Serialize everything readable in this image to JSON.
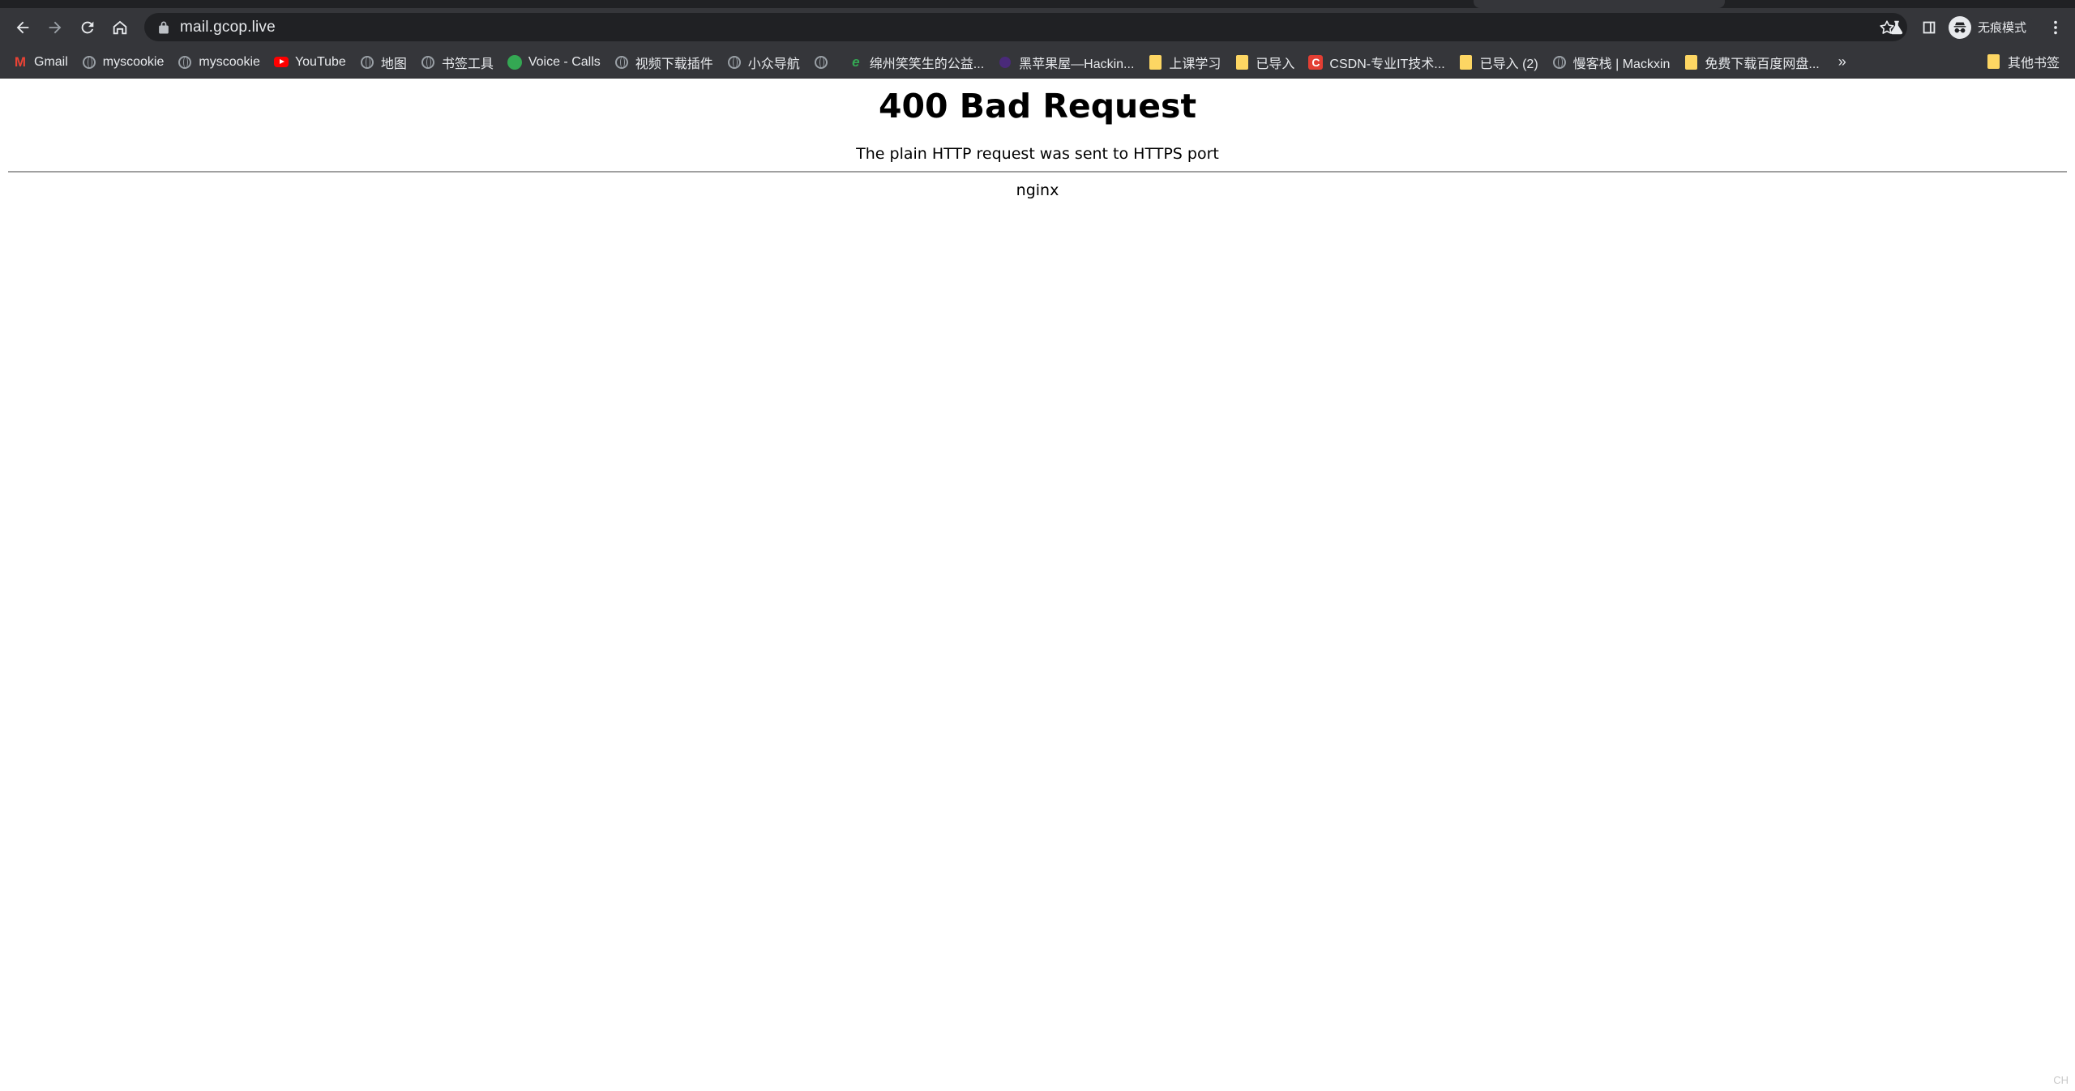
{
  "browser": {
    "url": "mail.gcop.live",
    "profile_label": "无痕模式"
  },
  "bookmarks": [
    {
      "label": "Gmail",
      "icon": "gmail-icon"
    },
    {
      "label": "myscookie",
      "icon": "globe-icon"
    },
    {
      "label": "myscookie",
      "icon": "globe-icon"
    },
    {
      "label": "YouTube",
      "icon": "youtube-icon"
    },
    {
      "label": "地图",
      "icon": "globe-icon"
    },
    {
      "label": "书签工具",
      "icon": "globe-icon"
    },
    {
      "label": "Voice - Calls",
      "icon": "voice-icon"
    },
    {
      "label": "视频下载插件",
      "icon": "globe-icon"
    },
    {
      "label": "小众导航",
      "icon": "globe-icon"
    },
    {
      "label": "",
      "icon": "globe-icon"
    },
    {
      "label": "绵州笑笑生的公益...",
      "icon": "e-icon"
    },
    {
      "label": "黑苹果屋—Hackin...",
      "icon": "purple-dot-icon"
    },
    {
      "label": "上课学习",
      "icon": "folder-icon"
    },
    {
      "label": "已导入",
      "icon": "folder-icon"
    },
    {
      "label": "CSDN-专业IT技术...",
      "icon": "csdn-icon"
    },
    {
      "label": "已导入 (2)",
      "icon": "folder-icon"
    },
    {
      "label": "慢客栈 | Mackxin",
      "icon": "globe-icon"
    },
    {
      "label": "免费下载百度网盘...",
      "icon": "folder-icon"
    }
  ],
  "bookmarks_more": "»",
  "other_bookmarks": "其他书签",
  "page": {
    "title": "400 Bad Request",
    "message": "The plain HTTP request was sent to HTTPS port",
    "server": "nginx"
  },
  "tray": {
    "ime": "CH"
  }
}
